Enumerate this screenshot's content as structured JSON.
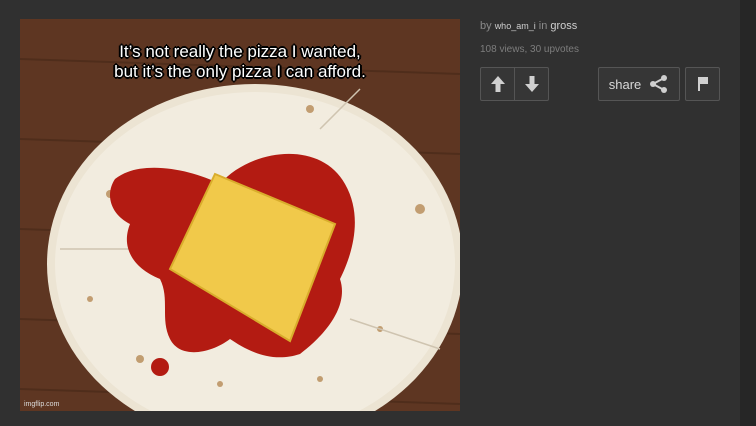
{
  "meme": {
    "caption_line1": "It’s not really the pizza I wanted,",
    "caption_line2": "but it’s the only pizza I can afford.",
    "watermark": "imgflip.com"
  },
  "meta": {
    "by_label": "by",
    "username": "who_am_i",
    "in_label": "in",
    "stream": "gross",
    "stats": "108 views, 30 upvotes"
  },
  "actions": {
    "share_label": "share",
    "upvote_icon": "arrow-up-icon",
    "downvote_icon": "arrow-down-icon",
    "share_icon": "share-icon",
    "flag_icon": "flag-icon"
  },
  "colors": {
    "background": "#303030",
    "button_border": "#555555",
    "text_muted": "#8a8a8a"
  }
}
